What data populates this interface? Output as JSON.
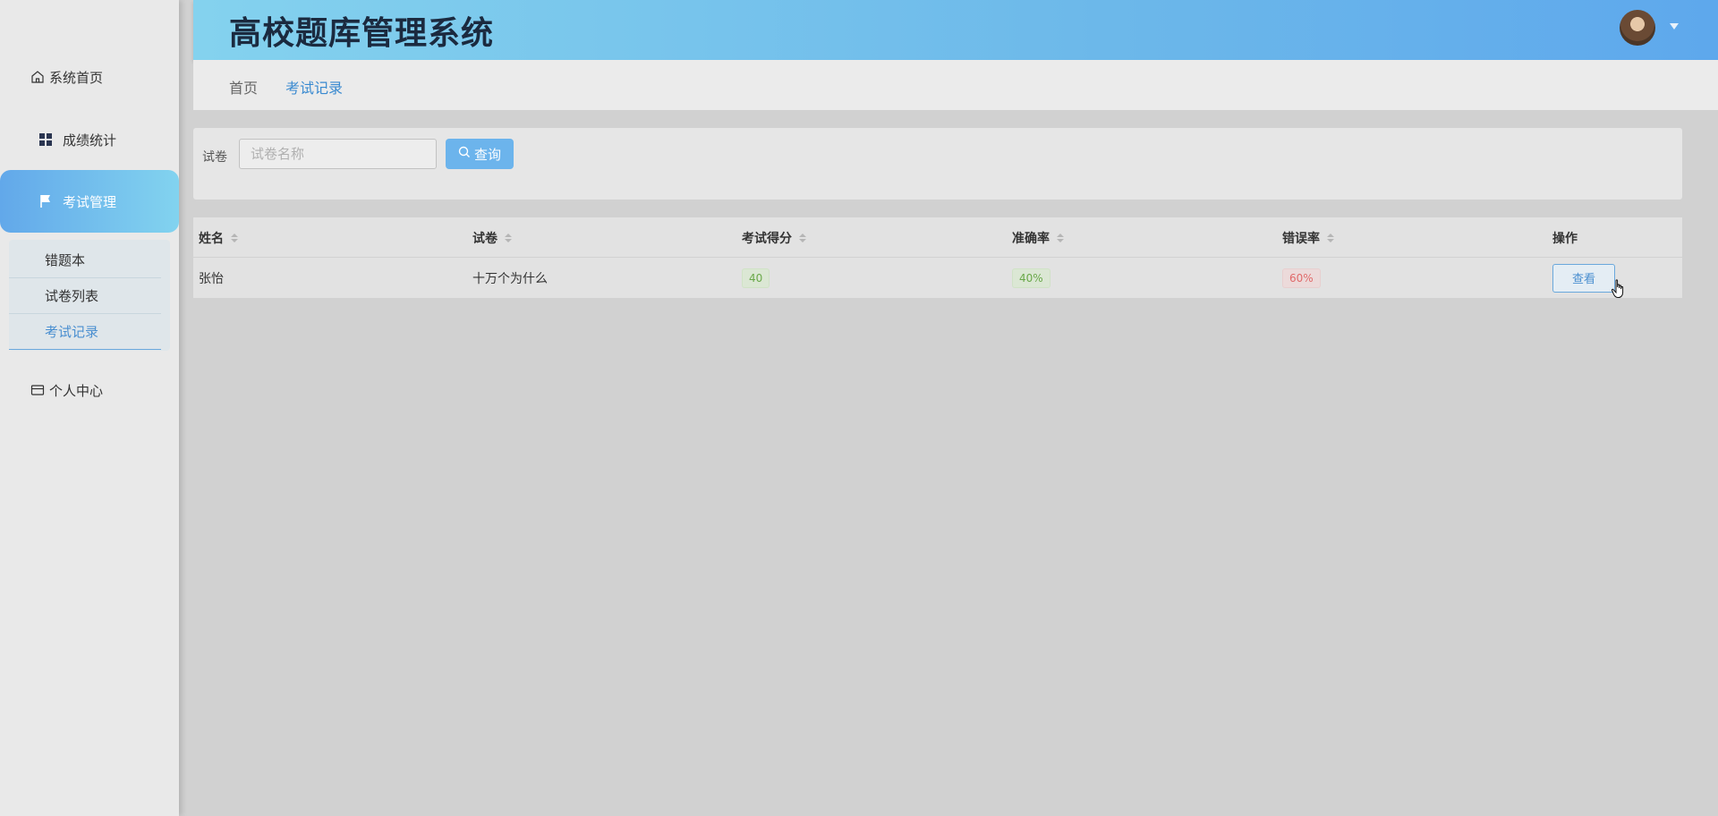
{
  "app": {
    "title": "高校题库管理系统"
  },
  "colors": {
    "accent": "#6cb4ec",
    "header_start": "#84d2ee",
    "header_end": "#5ea8ec",
    "tag_green": "#6aa84a",
    "tag_red": "#e06a6a"
  },
  "sidebar": {
    "items": [
      {
        "label": "系统首页",
        "icon": "home-icon"
      },
      {
        "label": "成绩统计",
        "icon": "grid-icon"
      },
      {
        "label": "考试管理",
        "icon": "flag-icon"
      },
      {
        "label": "个人中心",
        "icon": "card-icon"
      }
    ],
    "submenu": [
      {
        "label": "错题本"
      },
      {
        "label": "试卷列表"
      },
      {
        "label": "考试记录"
      }
    ]
  },
  "breadcrumb": {
    "home": "首页",
    "current": "考试记录"
  },
  "search": {
    "label": "试卷",
    "placeholder": "试卷名称",
    "button": "查询"
  },
  "table": {
    "headers": [
      "姓名",
      "试卷",
      "考试得分",
      "准确率",
      "错误率",
      "操作"
    ],
    "rows": [
      {
        "name": "张怡",
        "paper": "十万个为什么",
        "score": "40",
        "accuracy": "40%",
        "error_rate": "60%",
        "action": "查看"
      }
    ]
  }
}
